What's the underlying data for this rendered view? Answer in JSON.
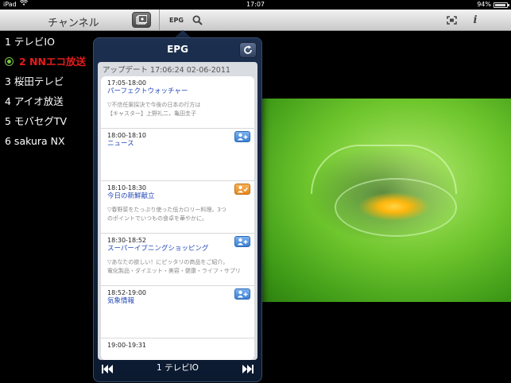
{
  "status_bar": {
    "device": "iPad",
    "time": "17:07",
    "battery": "94%",
    "battery_level": 0.94
  },
  "toolbar": {
    "title": "チャンネル",
    "epg_label": "EPG",
    "info_label": "i"
  },
  "channels": [
    {
      "label": "1 テレビIO",
      "active": false
    },
    {
      "label": "2 NNエコ放送",
      "active": true
    },
    {
      "label": "3 桜田テレビ",
      "active": false
    },
    {
      "label": "4 アイオ放送",
      "active": false
    },
    {
      "label": "5 モバセグTV",
      "active": false
    },
    {
      "label": "6 sakura NX",
      "active": false
    }
  ],
  "epg": {
    "title": "EPG",
    "updated": "アップデート 17:06:24 02-06-2011",
    "programs": [
      {
        "time": "17:05-18:00",
        "title": "パーフェクトウォッチャー",
        "desc1": "▽不信任案採決で今後の日本の行方は",
        "desc2": "【キャスター】上野礼二，亀田圭子",
        "button": "none"
      },
      {
        "time": "18:00-18:10",
        "title": "ニュース",
        "desc1": "",
        "desc2": "",
        "button": "add"
      },
      {
        "time": "18:10-18:30",
        "title": "今日の新鮮献立",
        "desc1": "▽春野菜をたっぷり使った低カロリー料理。3つ",
        "desc2": "のポイントでいつもの食卓を華やかに。",
        "button": "added"
      },
      {
        "time": "18:30-18:52",
        "title": "スーパーイブニングショッピング",
        "desc1": "▽あなたの欲しい！にピッタリの商品をご紹介。",
        "desc2": "電化製品・ダイエット・美容・健康・ライフ・サプリ",
        "button": "add"
      },
      {
        "time": "18:52-19:00",
        "title": "気象情報",
        "desc1": "",
        "desc2": "",
        "button": "add"
      },
      {
        "time": "19:00-19:31",
        "title": "",
        "desc1": "",
        "desc2": "",
        "button": "none"
      }
    ],
    "footer_channel": "1 テレビIO"
  },
  "colors": {
    "active_channel": "#e81b1b",
    "program_title": "#2348b8",
    "accent_blue": "#3b7fd3",
    "accent_orange": "#e8861a"
  }
}
